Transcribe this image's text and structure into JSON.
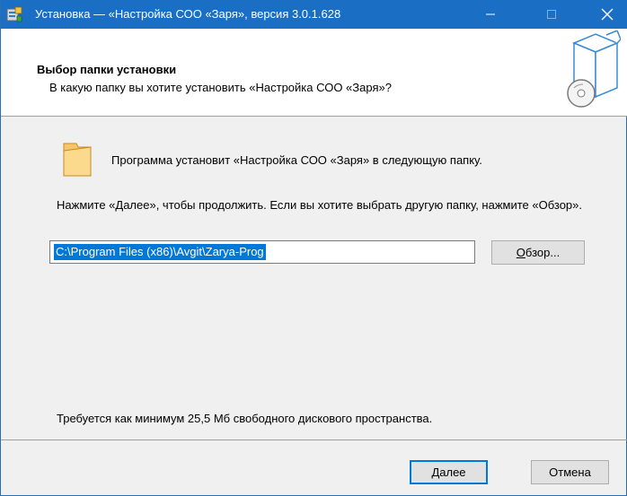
{
  "window": {
    "title": "Установка — «Настройка СОО «Заря», версия 3.0.1.628",
    "accent_color": "#1a6fc4",
    "controls": [
      "minimize-icon",
      "maximize-icon",
      "close-icon"
    ]
  },
  "header": {
    "title": "Выбор папки установки",
    "subtitle": "В какую папку вы хотите установить «Настройка СОО «Заря»?"
  },
  "body": {
    "intro": "Программа установит «Настройка СОО «Заря» в следующую папку.",
    "hint": "Нажмите «Далее», чтобы продолжить. Если вы хотите выбрать другую папку, нажмите «Обзор».",
    "path_value": "C:\\Program Files (x86)\\Avgit\\Zarya-Prog",
    "browse_label_u": "О",
    "browse_label_rest": "бзор...",
    "space_required": "Требуется как минимум 25,5 Мб свободного дискового пространства."
  },
  "footer": {
    "next_label_u": "Д",
    "next_label_rest": "алее",
    "cancel_label": "Отмена"
  }
}
